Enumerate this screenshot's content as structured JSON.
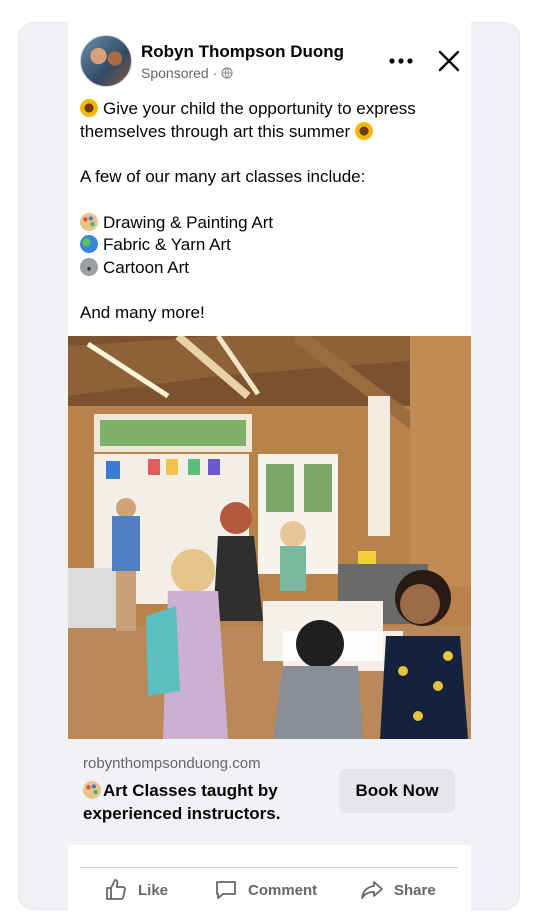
{
  "post": {
    "author": "Robyn Thompson Duong",
    "sponsored": "Sponsored ·",
    "intro_line": "Give your child the opportunity to express themselves through art this summer",
    "classes_heading": "A few of our many art classes include:",
    "classes": [
      {
        "icon": "artist-palette-icon",
        "label": "Drawing & Painting Art"
      },
      {
        "icon": "globe-icon",
        "label": "Fabric & Yarn Art"
      },
      {
        "icon": "koala-icon",
        "label": "Cartoon Art"
      }
    ],
    "closing": "And many more!"
  },
  "link_preview": {
    "domain": "robynthompsonduong.com",
    "headline": "Art Classes taught by experienced instructors.",
    "cta_label": "Book Now"
  },
  "actions": {
    "like": "Like",
    "comment": "Comment",
    "share": "Share"
  },
  "colors": {
    "background": "#f0f2f5",
    "secondary_text": "#65676b",
    "button_bg": "#e4e6eb"
  }
}
